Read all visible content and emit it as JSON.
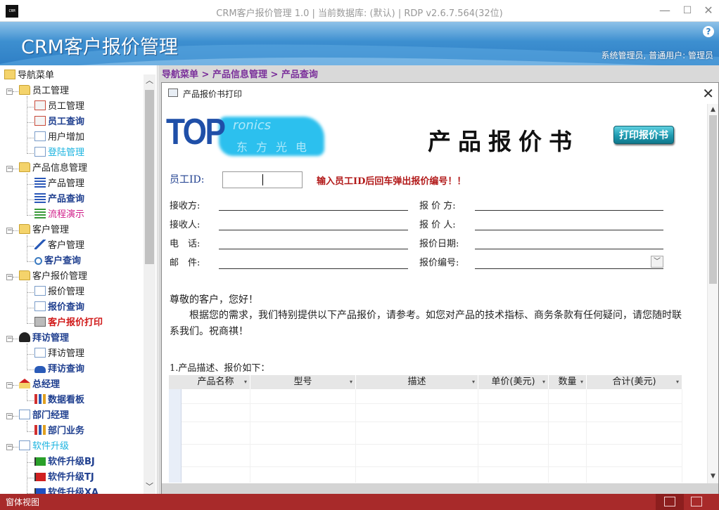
{
  "window": {
    "icon_text": "CRM",
    "title": "CRM客户报价管理 1.0 | 当前数据库: (默认) | RDP v2.6.7.564(32位)",
    "min": "—",
    "max": "☐",
    "close": "✕"
  },
  "header": {
    "title": "CRM客户报价管理",
    "user": "系统管理员, 普通用户: 管理员",
    "help": "?"
  },
  "sidebar": {
    "root": "导航菜单",
    "groups": [
      {
        "label": "员工管理",
        "items": [
          "员工管理",
          "员工查询",
          "用户增加",
          "登陆管理"
        ]
      },
      {
        "label": "产品信息管理",
        "items": [
          "产品管理",
          "产品查询",
          "流程演示"
        ]
      },
      {
        "label": "客户管理",
        "items": [
          "客户管理",
          "客户查询"
        ]
      },
      {
        "label": "客户报价管理",
        "items": [
          "报价管理",
          "报价查询",
          "客户报价打印"
        ]
      },
      {
        "label": "拜访管理",
        "items": [
          "拜访管理",
          "拜访查询"
        ]
      },
      {
        "label": "总经理",
        "items": [
          "数据看板"
        ]
      },
      {
        "label": "部门经理",
        "items": [
          "部门业务"
        ]
      },
      {
        "label": "软件升级",
        "items": [
          "软件升级BJ",
          "软件升级TJ",
          "软件升级XA"
        ]
      }
    ]
  },
  "breadcrumb": "导航菜单 > 产品信息管理 > 产品查询",
  "dialog": {
    "title": "产品报价书打印",
    "close": "✕",
    "logo": {
      "text": "TOP",
      "sub": "ronics",
      "cn": "东方光电"
    },
    "doc_title": "产品报价书",
    "print_label": "打印报价书",
    "employee_id_label": "员工ID:",
    "employee_id_value": "",
    "employee_hint": "输入员工ID后回车弹出报价编号！！",
    "fields": {
      "receiver": "接收方:",
      "quoter": "报 价 方:",
      "receiver_person": "接收人:",
      "quoter_person": "报 价 人:",
      "phone": "电　话:",
      "quote_date": "报价日期:",
      "email": "邮　件:",
      "quote_no": "报价编号:"
    },
    "greeting": "尊敬的客户，您好！",
    "intro": "根据您的需求，我们特别提供以下产品报价，请参考。如您对产品的技术指标、商务条款有任何疑问，请您随时联系我们。祝商祺！",
    "section_title": "1.产品描述、报价如下：",
    "table": {
      "columns": [
        "产品名称",
        "型号",
        "描述",
        "单价(美元)",
        "数量",
        "合计(美元)"
      ],
      "rows": []
    }
  },
  "statusbar": {
    "text": "窗体视图"
  },
  "colors": {
    "banner": "#2f7fc5",
    "statusbar": "#a82a2a",
    "breadcrumb": "#7a2f9a",
    "hint": "#b21a1a"
  }
}
